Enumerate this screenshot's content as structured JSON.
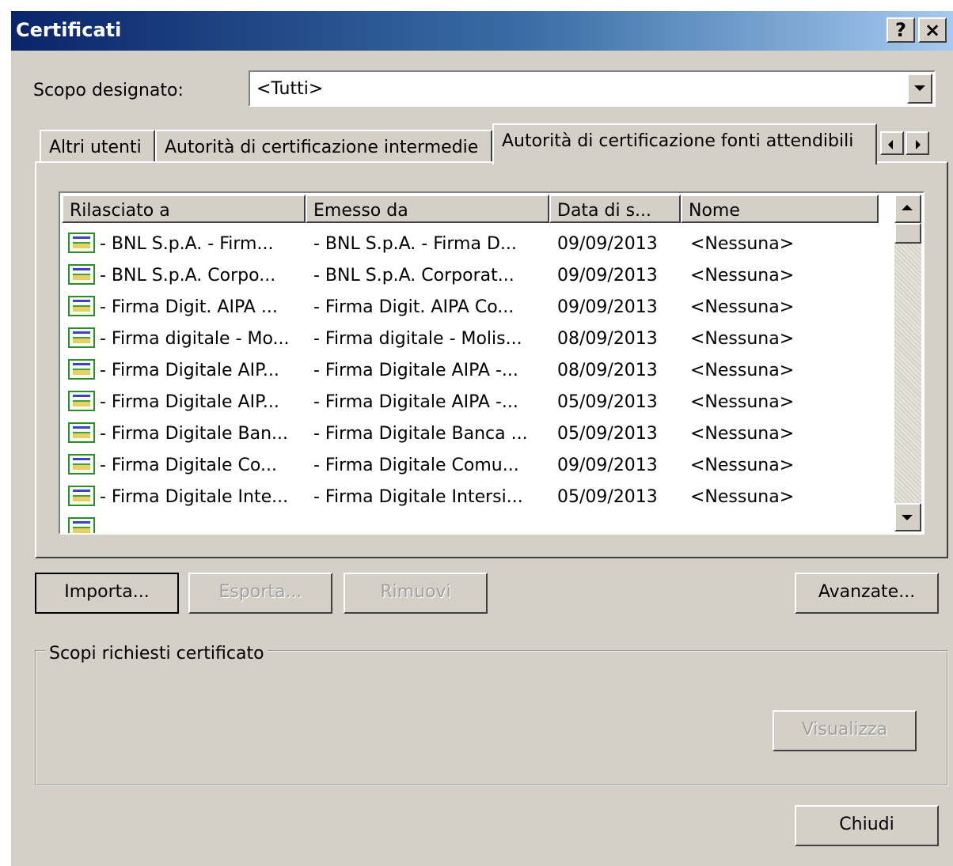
{
  "window": {
    "title": "Certificati",
    "help_label": "?",
    "close_label": "×"
  },
  "purpose": {
    "label": "Scopo designato:",
    "value": "<Tutti>"
  },
  "tabs": [
    {
      "label": "Altri utenti",
      "active": false
    },
    {
      "label": "Autorità di certificazione intermedie",
      "active": false
    },
    {
      "label": "Autorità di certificazione fonti attendibili",
      "active": true
    }
  ],
  "list": {
    "columns": [
      "Rilasciato a",
      "Emesso da",
      "Data di s...",
      "Nome"
    ],
    "rows": [
      {
        "issued_to": "- BNL S.p.A. - Firm...",
        "issued_by": "- BNL S.p.A. - Firma D...",
        "date": "09/09/2013",
        "name": "<Nessuna>"
      },
      {
        "issued_to": "- BNL S.p.A. Corpo...",
        "issued_by": "- BNL S.p.A. Corporat...",
        "date": "09/09/2013",
        "name": "<Nessuna>"
      },
      {
        "issued_to": "- Firma Digit. AIPA ...",
        "issued_by": "- Firma Digit. AIPA Co...",
        "date": "09/09/2013",
        "name": "<Nessuna>"
      },
      {
        "issued_to": "- Firma digitale - Mo...",
        "issued_by": "- Firma digitale - Molis...",
        "date": "08/09/2013",
        "name": "<Nessuna>"
      },
      {
        "issued_to": "- Firma Digitale AIP...",
        "issued_by": "- Firma Digitale AIPA -...",
        "date": "08/09/2013",
        "name": "<Nessuna>"
      },
      {
        "issued_to": "- Firma Digitale AIP...",
        "issued_by": "- Firma Digitale AIPA -...",
        "date": "05/09/2013",
        "name": "<Nessuna>"
      },
      {
        "issued_to": "- Firma Digitale Ban...",
        "issued_by": "- Firma Digitale Banca ...",
        "date": "05/09/2013",
        "name": "<Nessuna>"
      },
      {
        "issued_to": "- Firma Digitale Co...",
        "issued_by": "- Firma Digitale Comu...",
        "date": "09/09/2013",
        "name": "<Nessuna>"
      },
      {
        "issued_to": "- Firma Digitale Inte...",
        "issued_by": "- Firma Digitale Intersi...",
        "date": "05/09/2013",
        "name": "<Nessuna>"
      }
    ]
  },
  "buttons": {
    "import": "Importa...",
    "export": "Esporta...",
    "remove": "Rimuovi",
    "advanced": "Avanzate...",
    "view": "Visualizza",
    "close": "Chiudi"
  },
  "group": {
    "label": "Scopi richiesti certificato"
  },
  "colors": {
    "dialog_bg": "#d4d0c8",
    "title_start": "#0a246a",
    "title_end": "#a6caf0",
    "disabled_text": "#a0a0a0"
  }
}
